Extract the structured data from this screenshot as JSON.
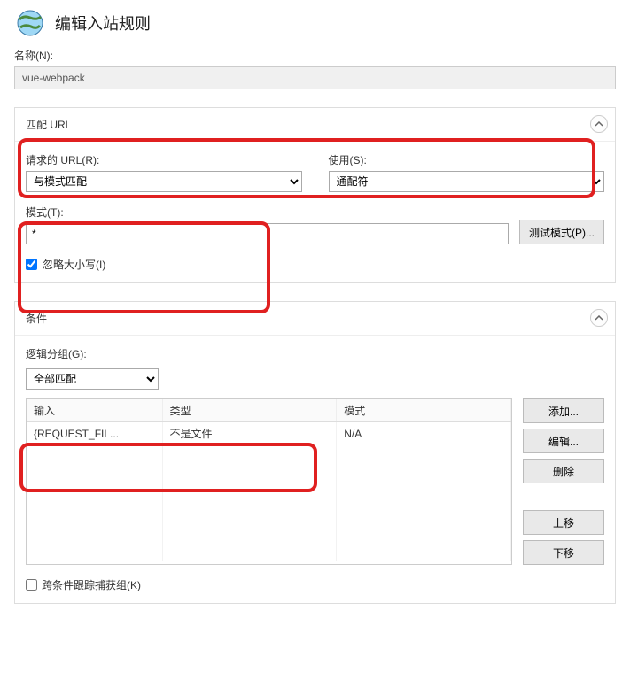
{
  "header": {
    "title": "编辑入站规则"
  },
  "name": {
    "label": "名称(N):",
    "value": "vue-webpack"
  },
  "matchUrl": {
    "panelTitle": "匹配 URL",
    "requestedUrl": {
      "label": "请求的 URL(R):",
      "value": "与模式匹配"
    },
    "using": {
      "label": "使用(S):",
      "value": "通配符"
    },
    "pattern": {
      "label": "模式(T):",
      "value": "*"
    },
    "testButton": "测试模式(P)...",
    "ignoreCase": "忽略大小写(I)"
  },
  "conditions": {
    "panelTitle": "条件",
    "logicGroup": {
      "label": "逻辑分组(G):",
      "value": "全部匹配"
    },
    "columns": {
      "input": "输入",
      "type": "类型",
      "pattern": "模式"
    },
    "rows": [
      {
        "input": "{REQUEST_FIL...",
        "type": "不是文件",
        "pattern": "N/A"
      }
    ],
    "buttons": {
      "add": "添加...",
      "edit": "编辑...",
      "delete": "删除",
      "moveUp": "上移",
      "moveDown": "下移"
    },
    "trackCapture": "跨条件跟踪捕获组(K)"
  }
}
